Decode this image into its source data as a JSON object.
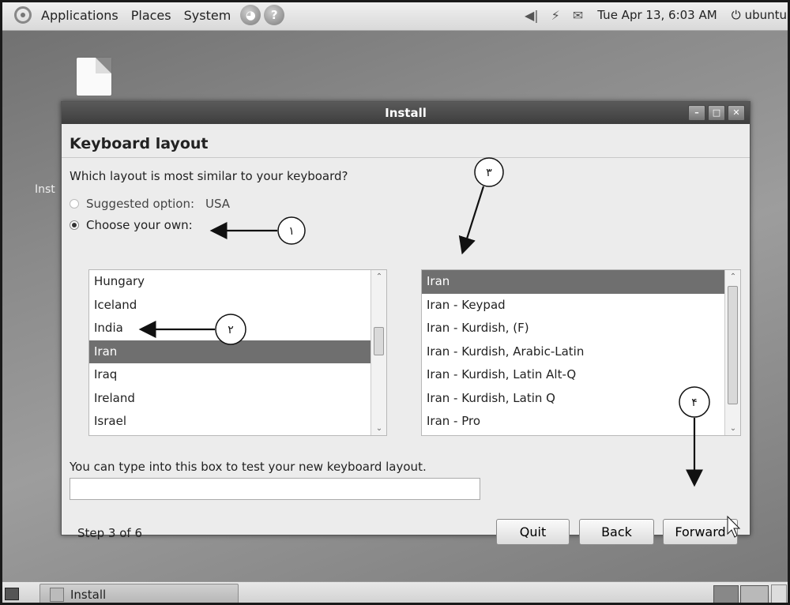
{
  "top_panel": {
    "menus": [
      "Applications",
      "Places",
      "System"
    ],
    "clock": "Tue Apr 13,  6:03 AM",
    "user": "ubuntu"
  },
  "desktop": {
    "icon_label": "Inst"
  },
  "window": {
    "title": "Install",
    "heading": "Keyboard layout",
    "question": "Which layout is most similar to your keyboard?",
    "suggested_label": "Suggested option:",
    "suggested_value": "USA",
    "choose_own_label": "Choose your own:",
    "countries": [
      "Hungary",
      "Iceland",
      "India",
      "Iran",
      "Iraq",
      "Ireland",
      "Israel"
    ],
    "selected_country": "Iran",
    "variants": [
      "Iran",
      "Iran - Keypad",
      "Iran - Kurdish, (F)",
      "Iran - Kurdish, Arabic-Latin",
      "Iran - Kurdish, Latin Alt-Q",
      "Iran - Kurdish, Latin Q",
      "Iran - Pro"
    ],
    "selected_variant": "Iran",
    "test_label": "You can type into this box to test your new keyboard layout.",
    "test_value": "",
    "step": "Step 3 of 6",
    "buttons": {
      "quit": "Quit",
      "back": "Back",
      "forward": "Forward"
    }
  },
  "annotations": [
    "۱",
    "۲",
    "۳",
    "۴"
  ],
  "taskbar": {
    "task_label": "Install"
  }
}
